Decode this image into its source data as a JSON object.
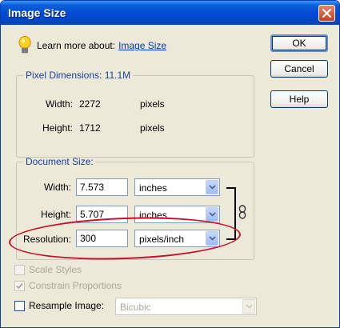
{
  "window": {
    "title": "Image Size"
  },
  "learn": {
    "prefix": "Learn more about:",
    "link": "Image Size"
  },
  "buttons": {
    "ok": "OK",
    "cancel": "Cancel",
    "help": "Help"
  },
  "pixel_dimensions": {
    "legend": "Pixel Dimensions:  11.1M",
    "width_label": "Width:",
    "width_value": "2272",
    "width_unit": "pixels",
    "height_label": "Height:",
    "height_value": "1712",
    "height_unit": "pixels"
  },
  "document_size": {
    "legend": "Document Size:",
    "width_label": "Width:",
    "width_value": "7.573",
    "width_unit": "inches",
    "height_label": "Height:",
    "height_value": "5.707",
    "height_unit": "inches",
    "resolution_label": "Resolution:",
    "resolution_value": "300",
    "resolution_unit": "pixels/inch"
  },
  "options": {
    "scale_styles": "Scale Styles",
    "constrain_proportions": "Constrain Proportions",
    "resample_label": "Resample Image:",
    "resample_method": "Bicubic"
  },
  "icons": [
    "close-icon",
    "lightbulb-icon",
    "chain-link-icon",
    "checkmark-icon",
    "dropdown-arrow-icon"
  ],
  "colors": {
    "titlebar": "#0349d6",
    "link": "#0033cc",
    "annotation": "#c8102e",
    "legend": "#1a3f9f"
  }
}
